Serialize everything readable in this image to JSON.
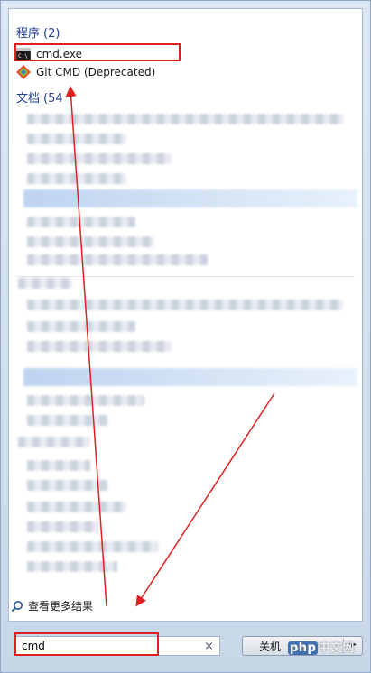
{
  "programs": {
    "title": "程序",
    "count": "(2)",
    "items": [
      {
        "label": "cmd.exe",
        "icon": "cmd-icon"
      },
      {
        "label": "Git CMD (Deprecated)",
        "icon": "git-icon"
      }
    ]
  },
  "documents": {
    "title": "文档",
    "count": "(54"
  },
  "more_results": "查看更多结果",
  "search": {
    "value": "cmd",
    "clear_icon": "×"
  },
  "shutdown": {
    "label": "关机",
    "arrow": "▶"
  },
  "watermark": {
    "php": "php",
    "text": "中文网"
  },
  "colors": {
    "annotation": "#e02020",
    "section_title": "#1e3d8f"
  }
}
